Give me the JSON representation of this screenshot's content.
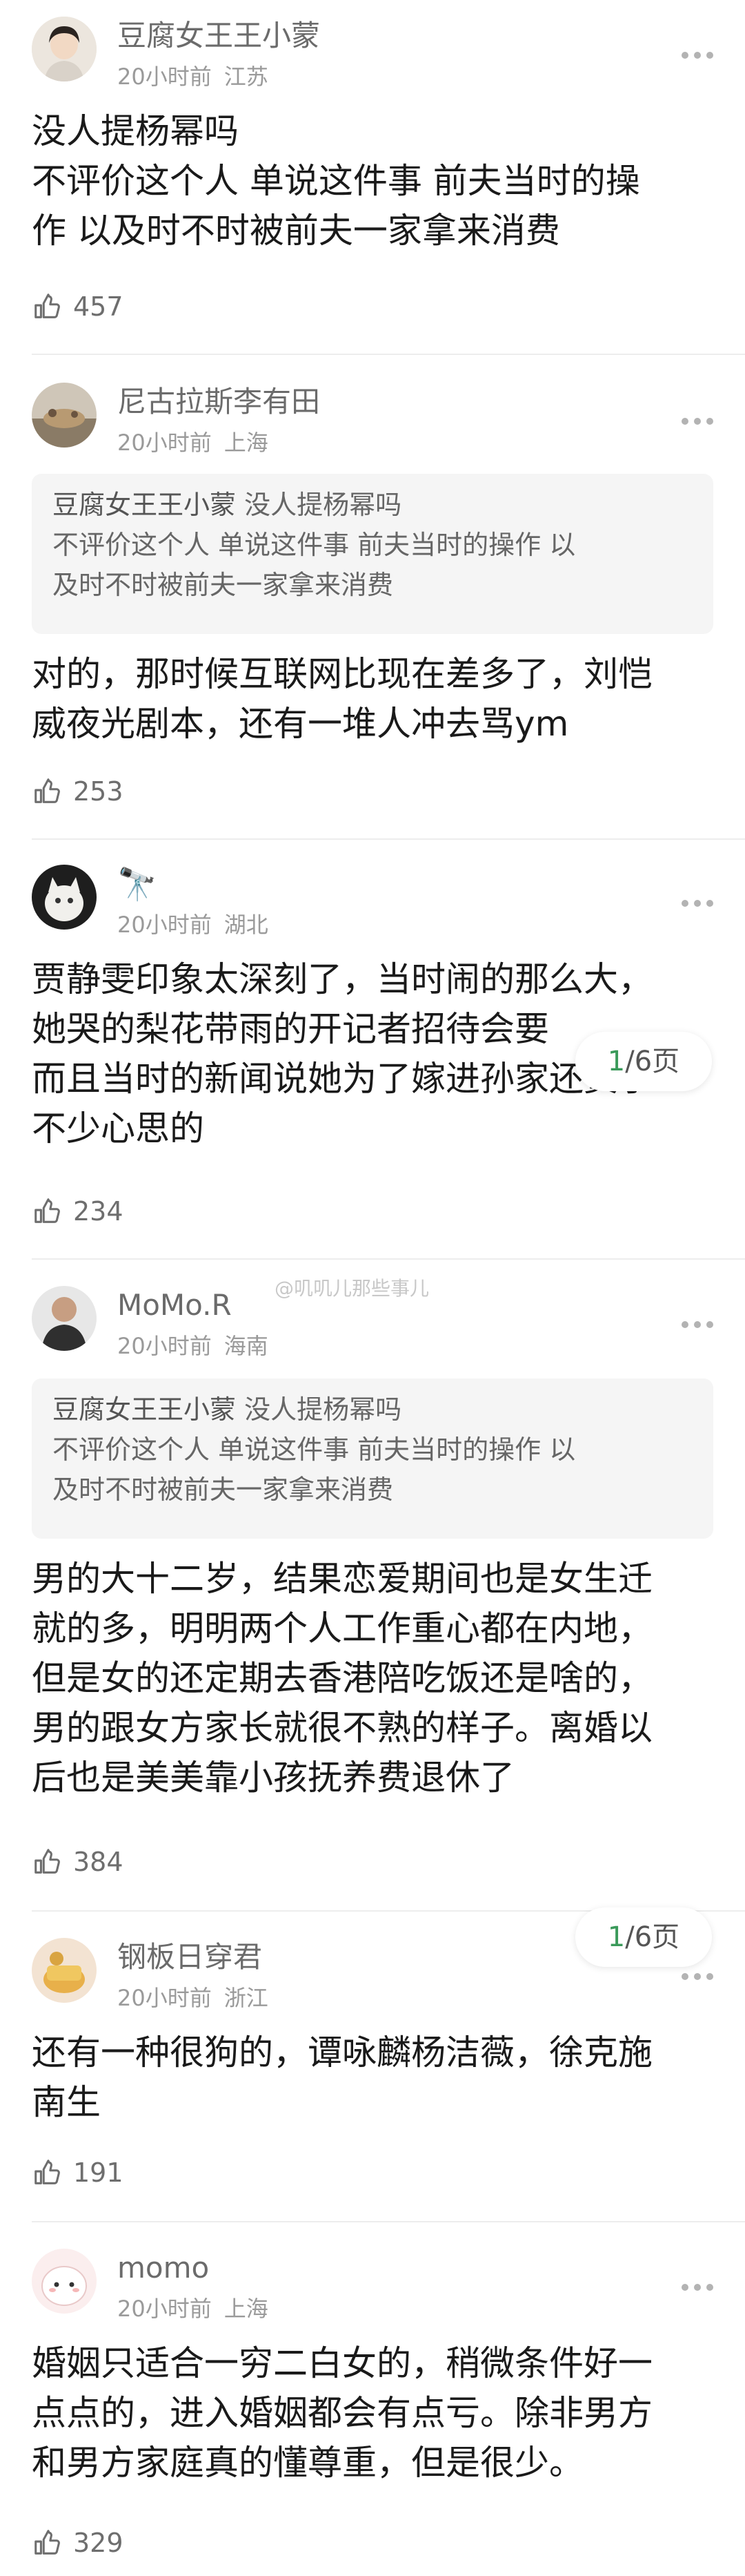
{
  "comments": [
    {
      "username": "豆腐女王王小蒙",
      "time": "20小时前",
      "location": "江苏",
      "text_lines": [
        "没人提杨幂吗",
        "不评价这个人 单说这件事 前夫当时的操",
        "作 以及时不时被前夫一家拿来消费"
      ],
      "likes": "457"
    },
    {
      "username": "尼古拉斯李有田",
      "time": "20小时前",
      "location": "上海",
      "quote_author": "豆腐女王王小蒙",
      "quote_lines": [
        "没人提杨幂吗",
        "不评价这个人 单说这件事 前夫当时的操作 以",
        "及时不时被前夫一家拿来消费"
      ],
      "text_lines": [
        "对的，那时候互联网比现在差多了，刘恺",
        "威夜光剧本，还有一堆人冲去骂ym"
      ],
      "likes": "253"
    },
    {
      "username": "🔭",
      "time": "20小时前",
      "location": "湖北",
      "text_lines": [
        "贾静雯印象太深刻了，当时闹的那么大，",
        "她哭的梨花带雨的开记者招待会要",
        "而且当时的新闻说她为了嫁进孙家还费了",
        "不少心思的"
      ],
      "likes": "234"
    },
    {
      "username": "MoMo.R",
      "time": "20小时前",
      "location": "海南",
      "quote_author": "豆腐女王王小蒙",
      "quote_lines": [
        "没人提杨幂吗",
        "不评价这个人 单说这件事 前夫当时的操作 以",
        "及时不时被前夫一家拿来消费"
      ],
      "text_lines": [
        "男的大十二岁，结果恋爱期间也是女生迁",
        "就的多，明明两个人工作重心都在内地，",
        "但是女的还定期去香港陪吃饭还是啥的，",
        "男的跟女方家长就很不熟的样子。离婚以",
        "后也是美美靠小孩抚养费退休了"
      ],
      "likes": "384"
    },
    {
      "username": "钢板日穿君",
      "time": "20小时前",
      "location": "浙江",
      "text_lines": [
        "还有一种很狗的，谭咏麟杨洁薇，徐克施",
        "南生"
      ],
      "likes": "191"
    },
    {
      "username": "momo",
      "time": "20小时前",
      "location": "上海",
      "text_lines": [
        "婚姻只适合一穷二白女的，稍微条件好一",
        "点点的，进入婚姻都会有点亏。除非男方",
        "和男方家庭真的懂尊重，但是很少。"
      ],
      "likes": "329"
    }
  ],
  "pager": {
    "current": "1",
    "total_text": "/6页"
  },
  "watermark": "@叽叽儿那些事儿",
  "icons": {
    "like": "thumbs-up-icon",
    "more": "more-dots-icon"
  },
  "colors": {
    "pager_current": "#3a9a5a",
    "divider": "#ededed",
    "quote_bg": "#f5f5f5"
  }
}
